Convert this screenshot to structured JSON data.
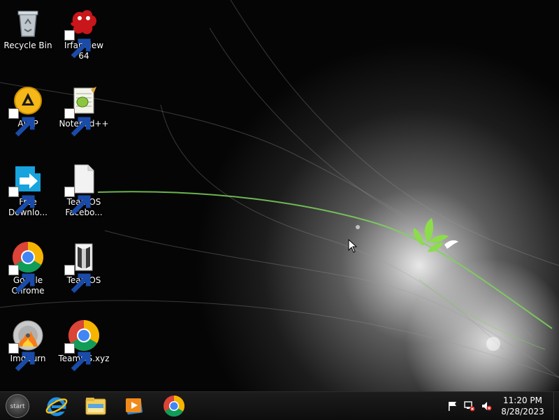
{
  "desktop": {
    "icons": [
      {
        "label": "Recycle Bin",
        "icon": "recycle-bin-icon",
        "shortcut": false
      },
      {
        "label": "IrfanView 64",
        "icon": "irfanview-icon",
        "shortcut": true
      },
      {
        "label": "AIMP",
        "icon": "aimp-icon",
        "shortcut": true
      },
      {
        "label": "Notepad++",
        "icon": "notepad-plus-plus-icon",
        "shortcut": true
      },
      {
        "label": "Free\nDownlo...",
        "icon": "free-download-manager-icon",
        "shortcut": true
      },
      {
        "label": "TeamOS\nFacebo...",
        "icon": "file-icon",
        "shortcut": true
      },
      {
        "label": "Google\nChrome",
        "icon": "chrome-icon",
        "shortcut": true
      },
      {
        "label": "TeamOS",
        "icon": "teamos-icon",
        "shortcut": true
      },
      {
        "label": "ImgBurn",
        "icon": "imgburn-icon",
        "shortcut": true
      },
      {
        "label": "TeamOS.xyz",
        "icon": "chrome-icon",
        "shortcut": true
      }
    ]
  },
  "taskbar": {
    "start_label": "start",
    "pinned": [
      {
        "name": "Internet Explorer",
        "icon": "internet-explorer-icon"
      },
      {
        "name": "File Explorer",
        "icon": "file-explorer-icon"
      },
      {
        "name": "Media Player",
        "icon": "media-player-icon"
      },
      {
        "name": "Google Chrome",
        "icon": "chrome-icon"
      }
    ],
    "tray": {
      "icons": [
        "action-center-flag-icon",
        "network-disconnected-icon",
        "volume-muted-icon"
      ],
      "time": "11:20 PM",
      "date": "8/28/2023"
    }
  },
  "colors": {
    "taskbar": "#141414",
    "wallpaper_accent": "#7ed35a"
  }
}
